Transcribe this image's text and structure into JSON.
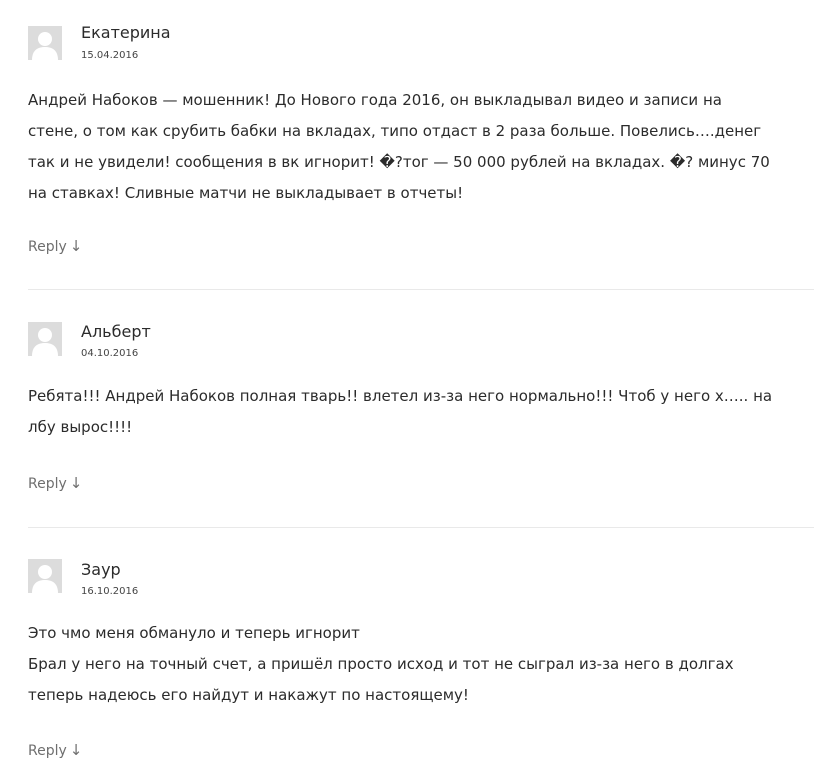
{
  "comments": [
    {
      "author": "Екатерина",
      "date": "15.04.2016",
      "lines": [
        "Андрей Набоков — мошенник! До Нового года 2016, он выкладывал видео и записи на",
        "стене, о том как срубить бабки на вкладах, типо отдаст в 2 раза больше. Повелись….денег",
        "так и не увидели! сообщения в вк игнорит! �?тог — 50 000 рублей на вкладах. �? минус 70",
        "на ставках! Сливные матчи не выкладывает в отчеты!"
      ],
      "reply_label": "Reply",
      "reply_icon": "↓"
    },
    {
      "author": "Альберт",
      "date": "04.10.2016",
      "lines": [
        "Ребята!!! Андрей Набоков полная тварь!! влетел из-за него нормально!!! Чтоб у него х….. на",
        "лбу вырос!!!!"
      ],
      "reply_label": "Reply",
      "reply_icon": "↓"
    },
    {
      "author": "Заур",
      "date": "16.10.2016",
      "lines": [
        "Это чмо меня обмануло и теперь игнорит",
        "Брал у него на точный счет, а пришёл просто исход и тот не сыграл из-за него в долгах",
        "теперь надеюсь его найдут и накажут по настоящему!"
      ],
      "reply_label": "Reply",
      "reply_icon": "↓"
    }
  ],
  "icons": {
    "avatar": "default-user-avatar-icon",
    "reply_arrow": "arrow-down-icon"
  }
}
